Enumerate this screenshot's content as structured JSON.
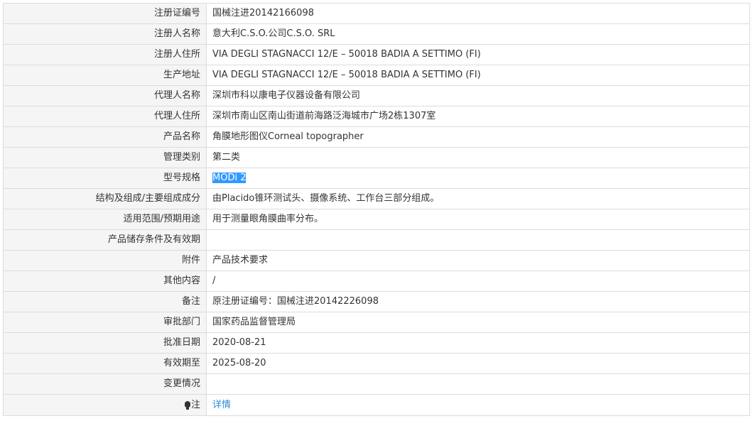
{
  "rows": [
    {
      "label": "注册证编号",
      "value": "国械注进20142166098"
    },
    {
      "label": "注册人名称",
      "value": "意大利C.S.O.公司C.S.O. SRL"
    },
    {
      "label": "注册人住所",
      "value": "VIA DEGLI STAGNACCI 12/E – 50018 BADIA A SETTIMO (FI)"
    },
    {
      "label": "生产地址",
      "value": "VIA DEGLI STAGNACCI 12/E – 50018 BADIA A SETTIMO (FI)"
    },
    {
      "label": "代理人名称",
      "value": "深圳市科以康电子仪器设备有限公司"
    },
    {
      "label": "代理人住所",
      "value": "深圳市南山区南山街道前海路泛海城市广场2栋1307室"
    },
    {
      "label": "产品名称",
      "value": "角膜地形图仪Corneal topographer"
    },
    {
      "label": "管理类别",
      "value": "第二类"
    },
    {
      "label": "型号规格",
      "value": "MODi 2"
    },
    {
      "label": "结构及组成/主要组成成分",
      "value": "由Placido锥环测试头、摄像系统、工作台三部分组成。"
    },
    {
      "label": "适用范围/预期用途",
      "value": "用于测量眼角膜曲率分布。"
    },
    {
      "label": "产品储存条件及有效期",
      "value": ""
    },
    {
      "label": "附件",
      "value": "产品技术要求"
    },
    {
      "label": "其他内容",
      "value": "/"
    },
    {
      "label": "备注",
      "value": "原注册证编号：国械注进20142226098"
    },
    {
      "label": "审批部门",
      "value": "国家药品监督管理局"
    },
    {
      "label": "批准日期",
      "value": "2020-08-21"
    },
    {
      "label": "有效期至",
      "value": "2025-08-20"
    },
    {
      "label": "变更情况",
      "value": ""
    }
  ],
  "note_row": {
    "icon": "lightbulb-icon",
    "label": "注",
    "link_text": "详情"
  },
  "colors": {
    "label_bg": "#f5f5f5",
    "border": "#dcdcdc",
    "selection": "#3399ff",
    "link": "#2b8bd6"
  }
}
